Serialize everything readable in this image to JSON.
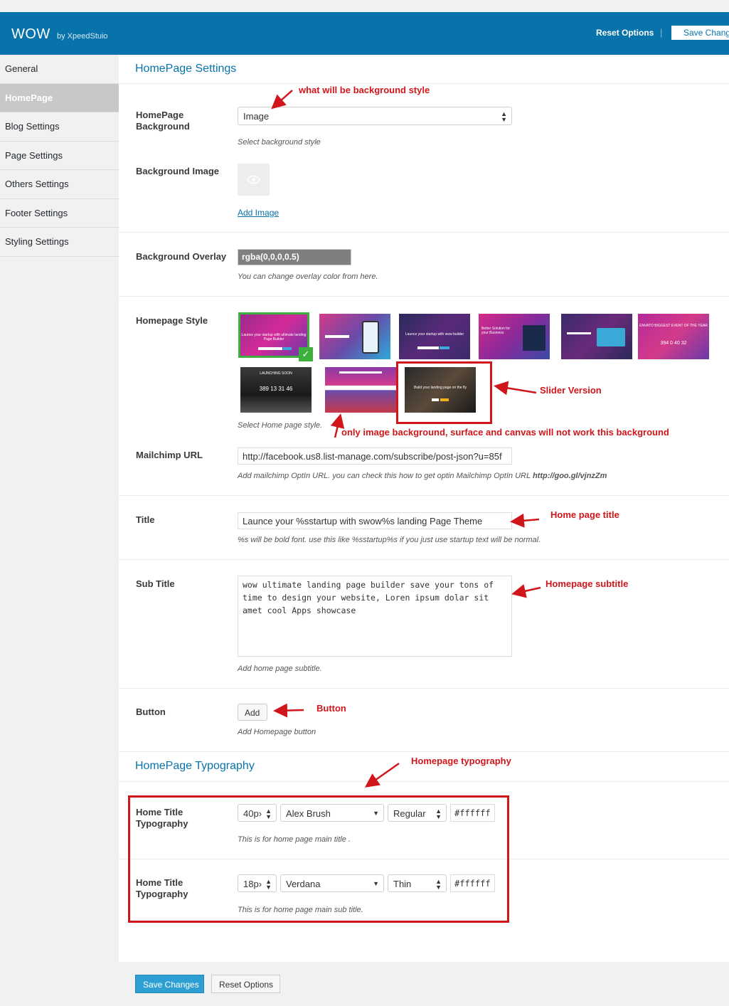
{
  "header": {
    "brand": "WOW",
    "by": "by XpeedStuio",
    "reset_label": "Reset Options",
    "separator": "|",
    "save_label": "Save Chang",
    "bg_color": "#0873aa"
  },
  "sidebar": {
    "items": [
      {
        "label": "General"
      },
      {
        "label": "HomePage"
      },
      {
        "label": "Blog Settings"
      },
      {
        "label": "Page Settings"
      },
      {
        "label": "Others Settings"
      },
      {
        "label": "Footer Settings"
      },
      {
        "label": "Styling Settings"
      }
    ],
    "active_index": 1
  },
  "homepage": {
    "section_title": "HomePage Settings",
    "background": {
      "label_line1": "HomePage",
      "label_line2": "Background",
      "value": "Image",
      "desc": "Select background style"
    },
    "background_image": {
      "label": "Background Image",
      "add_link": "Add Image"
    },
    "overlay": {
      "label": "Background Overlay",
      "value": "rgba(0,0,0,0.5)",
      "desc": "You can change overlay color from here."
    },
    "style": {
      "label": "Homepage Style",
      "desc": "Select Home page style.",
      "selected_index": 0,
      "thumbs": [
        {
          "caption": "Launce your startup with ultimate landing Page Builder"
        },
        {
          "caption": ""
        },
        {
          "caption": "Launce your startup with wow builder"
        },
        {
          "caption": "Better Solution for your Business"
        },
        {
          "caption": ""
        },
        {
          "caption": "ENVATO BIGGEST EVENT OF THE YEAR",
          "numbers": "394   0   40   32"
        },
        {
          "caption": "LAUNCHING SOON",
          "numbers": "389   13   31   46"
        },
        {
          "caption": ""
        },
        {
          "caption": "Build your landing page on the fly"
        }
      ]
    },
    "mailchimp": {
      "label": "Mailchimp URL",
      "value": "http://facebook.us8.list-manage.com/subscribe/post-json?u=85f",
      "desc_italic": "Add mailchimp OptIn URL. you can check this how to get optin Mailchimp OptIn URL ",
      "desc_link": "http://goo.gl/vjnzZm"
    },
    "title": {
      "label": "Title",
      "value": "Launce your %sstartup with swow%s landing Page Theme",
      "desc": "%s will be bold font. use this like %sstartup%s if you just use startup text will be normal."
    },
    "subtitle": {
      "label": "Sub Title",
      "value": "wow ultimate landing page builder save your tons of time to design your website, Loren ipsum dolar sit amet cool Apps showcase",
      "desc": "Add home page subtitle."
    },
    "button": {
      "label": "Button",
      "add_label": "Add",
      "desc": "Add Homepage button"
    }
  },
  "typography": {
    "section_title": "HomePage Typography",
    "rows": [
      {
        "label_line1": "Home Title",
        "label_line2": "Typography",
        "size": "40p›",
        "font": "Alex Brush",
        "weight": "Regular",
        "color": "#ffffff",
        "desc": "This is for home page main title ."
      },
      {
        "label_line1": "Home Title",
        "label_line2": "Typography",
        "size": "18p›",
        "font": "Verdana",
        "weight": "Thin",
        "color": "#ffffff",
        "desc": "This is for home page main sub title."
      }
    ]
  },
  "footer": {
    "save_label": "Save Changes",
    "reset_label": "Reset Options"
  },
  "annotations": {
    "bg_style": "what will be background style",
    "slider": "Slider Version",
    "only_image": "only image background, surface and canvas will not work this background",
    "home_title": "Home page title",
    "subtitle": "Homepage subtitle",
    "button": "Button",
    "typography": "Homepage typography",
    "color": "#d0161b"
  }
}
